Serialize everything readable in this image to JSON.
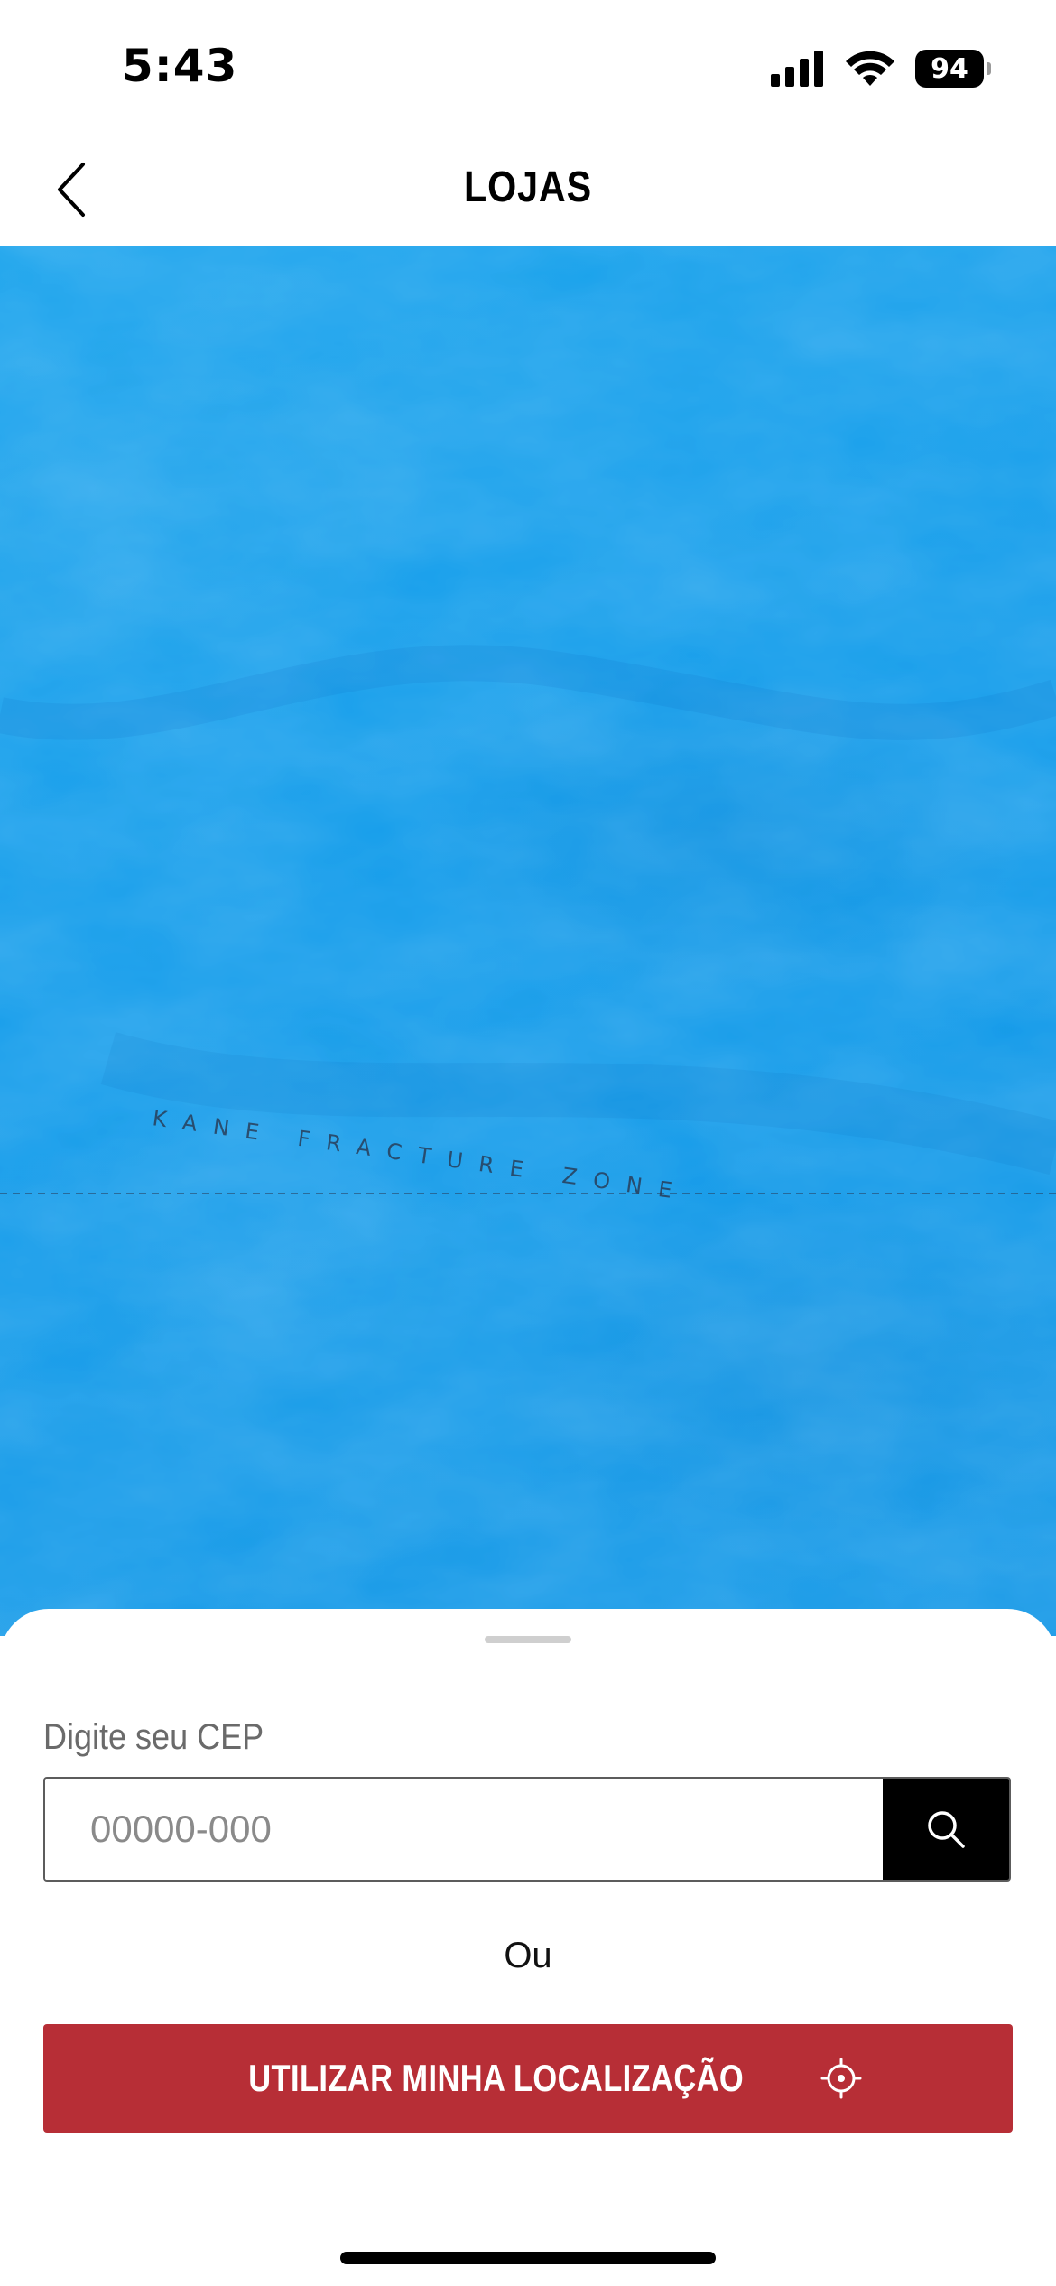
{
  "status_bar": {
    "time": "5:43",
    "battery_level": "94",
    "icons": [
      "signal-icon",
      "wifi-icon",
      "battery-icon"
    ]
  },
  "header": {
    "title": "LOJAS",
    "back_icon": "chevron-left-icon"
  },
  "map": {
    "label": "KANE FRACTURE ZONE",
    "water_color": "#139cea"
  },
  "bottom_sheet": {
    "cep_label": "Digite seu CEP",
    "cep_placeholder": "00000-000",
    "cep_value": "",
    "search_icon": "search-icon",
    "or_text": "Ou",
    "location_button_label": "UTILIZAR MINHA LOCALIZAÇÃO",
    "location_icon": "crosshair-icon"
  },
  "colors": {
    "accent_red": "#b72e36",
    "search_button": "#000000"
  }
}
